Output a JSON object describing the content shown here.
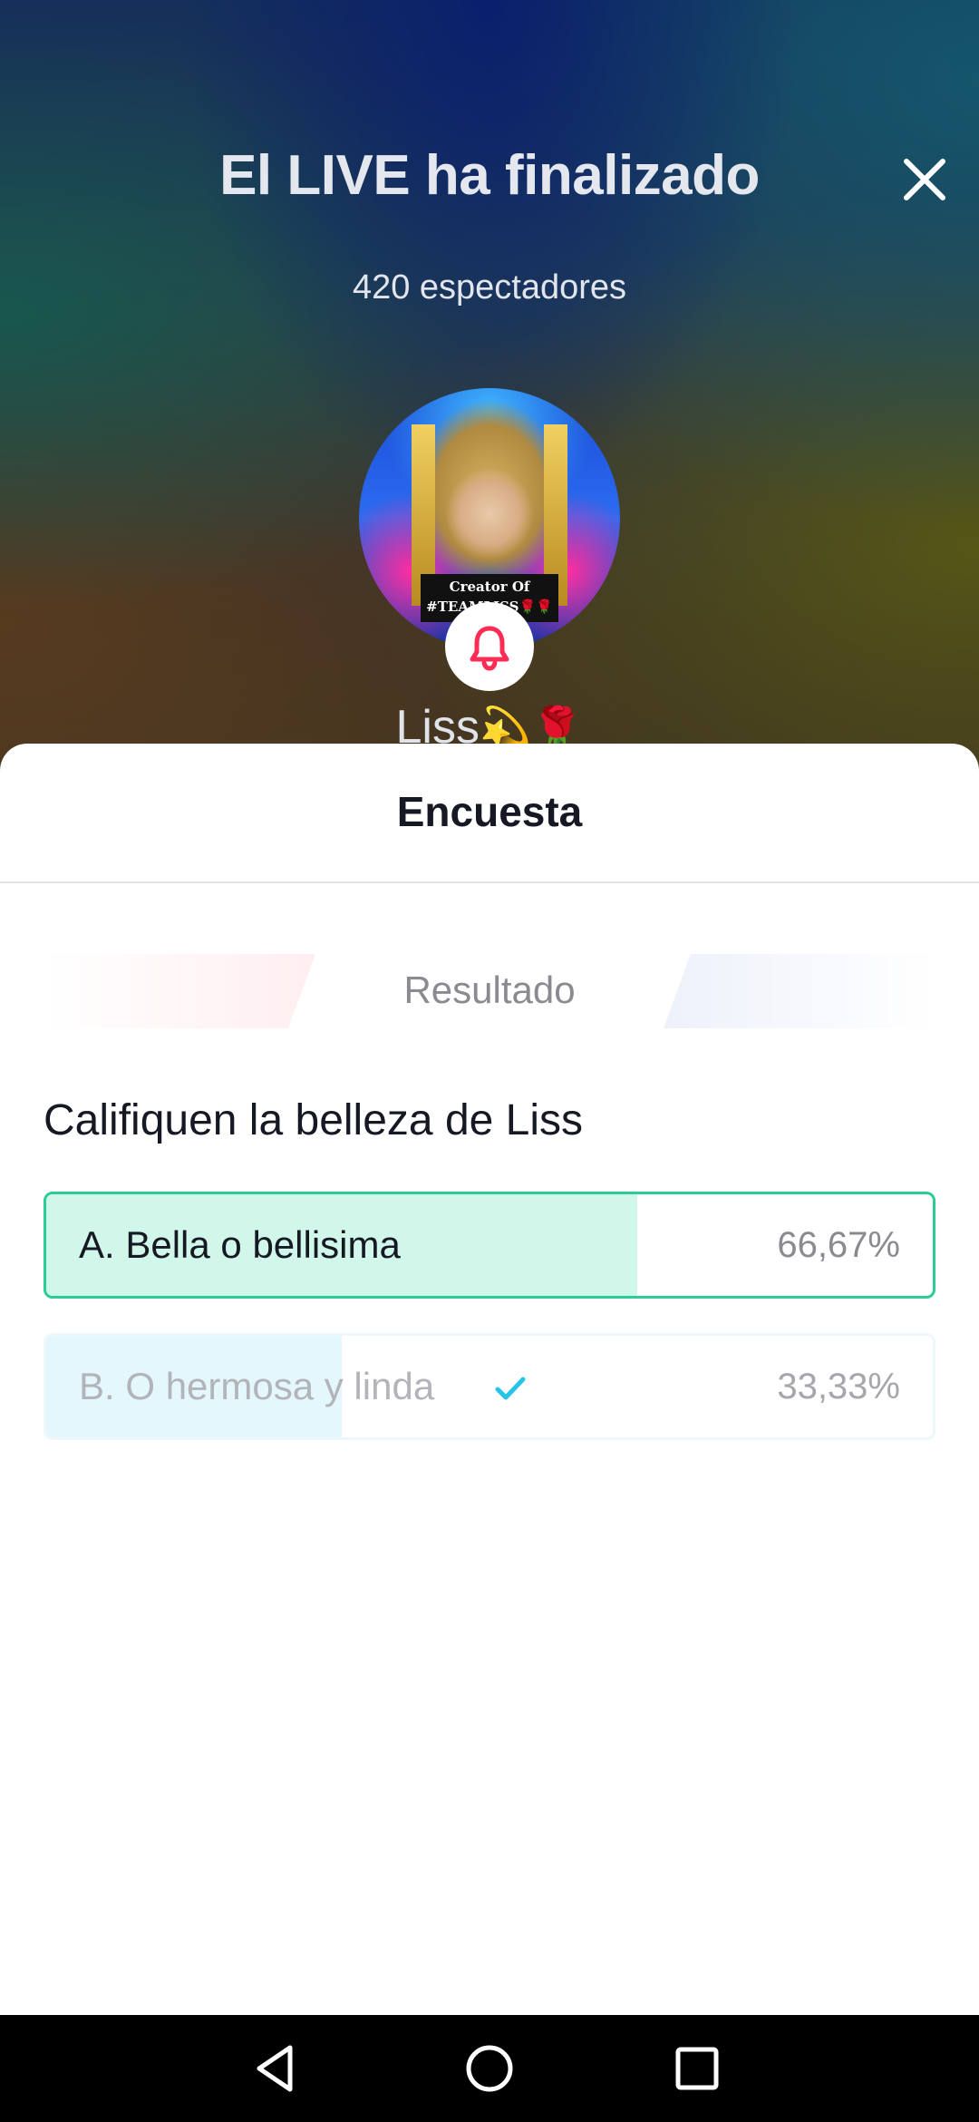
{
  "header": {
    "title": "El LIVE ha finalizado",
    "viewers": "420 espectadores",
    "close_icon": "close-icon"
  },
  "host": {
    "name": "Liss",
    "name_emoji": "💫🌹",
    "avatar_badge_line1": "Creator Of",
    "avatar_badge_line2": "#TEAMLISS🌹🌹",
    "bell_icon": "bell-icon"
  },
  "sheet": {
    "title": "Encuesta",
    "tab_label": "Resultado",
    "question": "Califiquen la belleza de Liss",
    "options": [
      {
        "label": "A. Bella o bellisima",
        "percent": "66,67%",
        "fill_fraction": 0.6667,
        "selected_by_user": false,
        "leading": true
      },
      {
        "label": "B. O hermosa y linda",
        "percent": "33,33%",
        "fill_fraction": 0.3333,
        "selected_by_user": true,
        "leading": false
      }
    ]
  },
  "nav": {
    "back_icon": "back-icon",
    "home_icon": "home-icon",
    "recents_icon": "recents-icon"
  },
  "colors": {
    "accent_green": "#2ccc98",
    "leading_fill": "#d0f7e9",
    "other_fill": "#e4f7fc",
    "check_color": "#25c4e8",
    "bell_red": "#fe2c55"
  }
}
